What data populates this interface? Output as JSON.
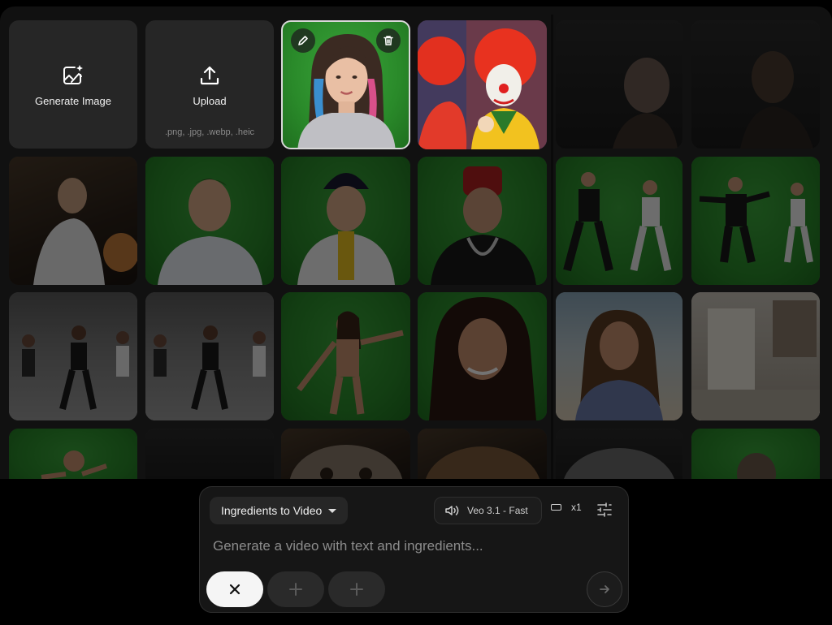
{
  "actions": {
    "generate_label": "Generate Image",
    "upload_label": "Upload",
    "upload_formats": ".png, .jpg, .webp, .heic"
  },
  "selected_ingredient": {
    "edit_icon": "pencil-icon",
    "delete_icon": "trash-icon"
  },
  "composer": {
    "mode_label": "Ingredients to Video",
    "model_label": "Veo 3.1 - Fast",
    "count_label": "x1",
    "placeholder": "Generate a video with text and ingredients...",
    "icons": {
      "mode_caret": "caret-down-icon",
      "audio": "speaker-icon",
      "aspect": "aspect-ratio-icon",
      "settings": "sliders-icon",
      "remove": "close-icon",
      "add": "plus-icon",
      "send": "arrow-right-icon"
    }
  },
  "colors": {
    "background": "#000000",
    "panel": "#111111",
    "tile": "#262626",
    "green_screen": "#3aa43a"
  }
}
